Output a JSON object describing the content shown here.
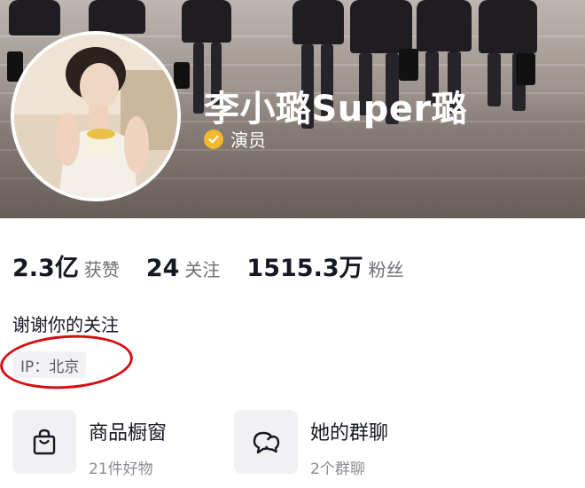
{
  "profile": {
    "nickname": "李小璐Super璐",
    "verify_label": "演员",
    "verify_icon": "verified-badge-icon",
    "verify_color": "#f5b72c"
  },
  "stats": [
    {
      "value": "2.3亿",
      "label": "获赞"
    },
    {
      "value": "24",
      "label": "关注"
    },
    {
      "value": "1515.3万",
      "label": "粉丝"
    }
  ],
  "bio": "谢谢你的关注",
  "ip_location": "IP：北京",
  "annotation_color": "#d40f14",
  "entries": [
    {
      "title": "商品橱窗",
      "subtitle": "21件好物",
      "icon": "shopping-bag-icon"
    },
    {
      "title": "她的群聊",
      "subtitle": "2个群聊",
      "icon": "group-chat-icon"
    }
  ]
}
